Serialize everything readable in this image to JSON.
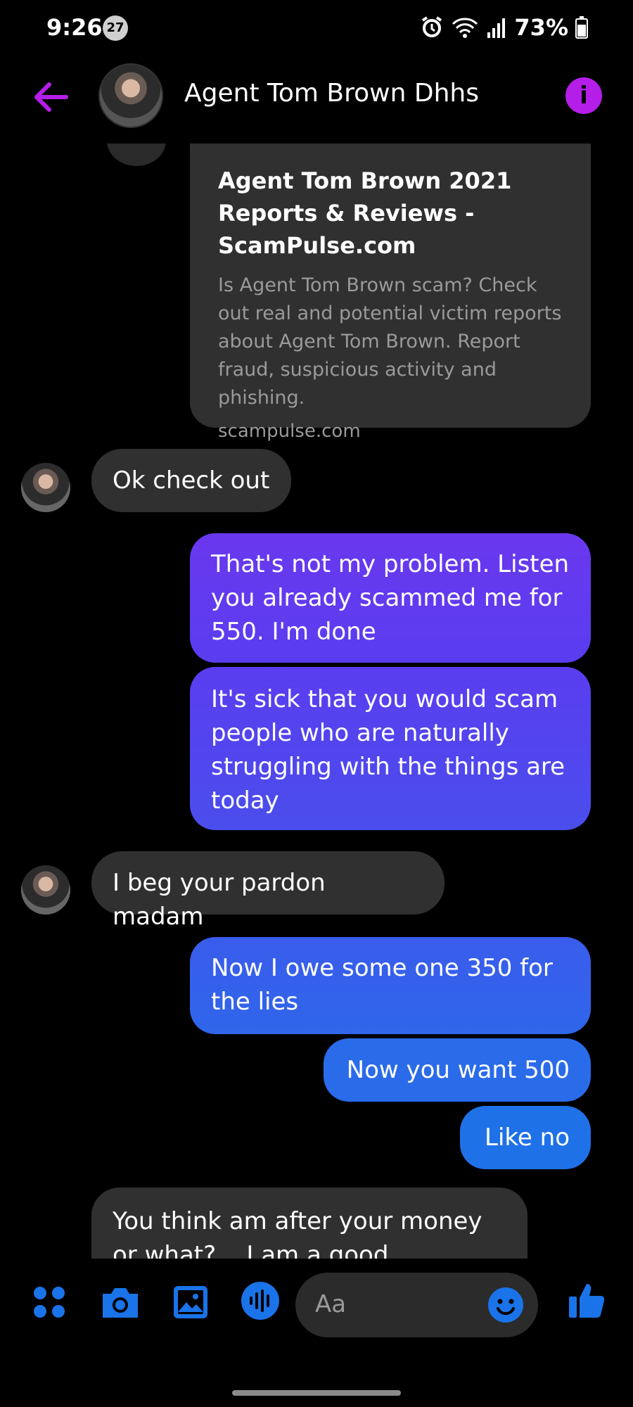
{
  "status_bar": {
    "time": "9:26",
    "notification_count": "27",
    "battery": "73%"
  },
  "header": {
    "contact_name": "Agent Tom Brown Dhhs",
    "info_glyph": "i"
  },
  "link_preview": {
    "title": "Agent Tom Brown 2021 Reports & Reviews - ScamPulse.com",
    "description": "Is Agent Tom Brown scam? Check out real and potential victim reports about Agent Tom Brown. Report fraud, suspicious activity and phishing.",
    "domain": "scampulse.com"
  },
  "messages": [
    {
      "sender": "them",
      "text": "Ok check out"
    },
    {
      "sender": "me",
      "text": "That's not my problem. Listen you already scammed me for 550. I'm done"
    },
    {
      "sender": "me",
      "text": "It's sick that you would scam people who are naturally struggling with the things are today"
    },
    {
      "sender": "them",
      "text": "I beg your pardon madam"
    },
    {
      "sender": "me",
      "text": "Now I owe some one 350 for the lies"
    },
    {
      "sender": "me",
      "text": "Now you want 500"
    },
    {
      "sender": "me",
      "text": "Like no"
    },
    {
      "sender": "them",
      "text": "You think am after your money or what?....I am a good"
    }
  ],
  "composer": {
    "placeholder": "Aa",
    "icons": [
      "menu-grid-icon",
      "camera-icon",
      "gallery-icon",
      "voice-icon",
      "emoji-icon",
      "thumbs-up-icon"
    ]
  },
  "colors": {
    "accent": "#b51ee8",
    "blue": "#1a73e8",
    "outgoing_gradient_top": "#6a38ee",
    "outgoing_gradient_bottom": "#1a73e8",
    "incoming_bubble": "#303030"
  }
}
